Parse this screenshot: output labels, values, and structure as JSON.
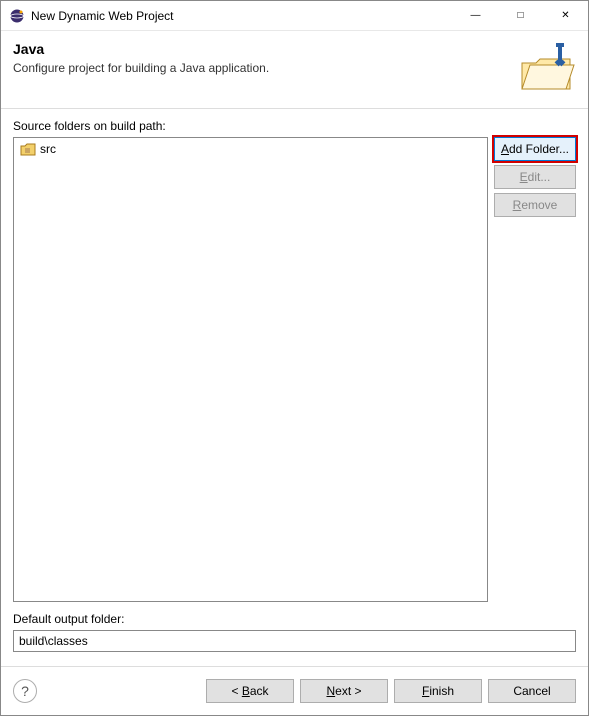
{
  "window": {
    "title": "New Dynamic Web Project"
  },
  "banner": {
    "heading": "Java",
    "subheading": "Configure project for building a Java application."
  },
  "folders": {
    "label": "Source folders on build path:",
    "items": [
      {
        "name": "src"
      }
    ]
  },
  "side": {
    "add": "Add Folder...",
    "edit": "Edit...",
    "remove": "Remove"
  },
  "output": {
    "label": "Default output folder:",
    "value": "build\\classes"
  },
  "footer": {
    "back": "Back",
    "next": "Next",
    "finish": "Finish",
    "cancel": "Cancel"
  }
}
